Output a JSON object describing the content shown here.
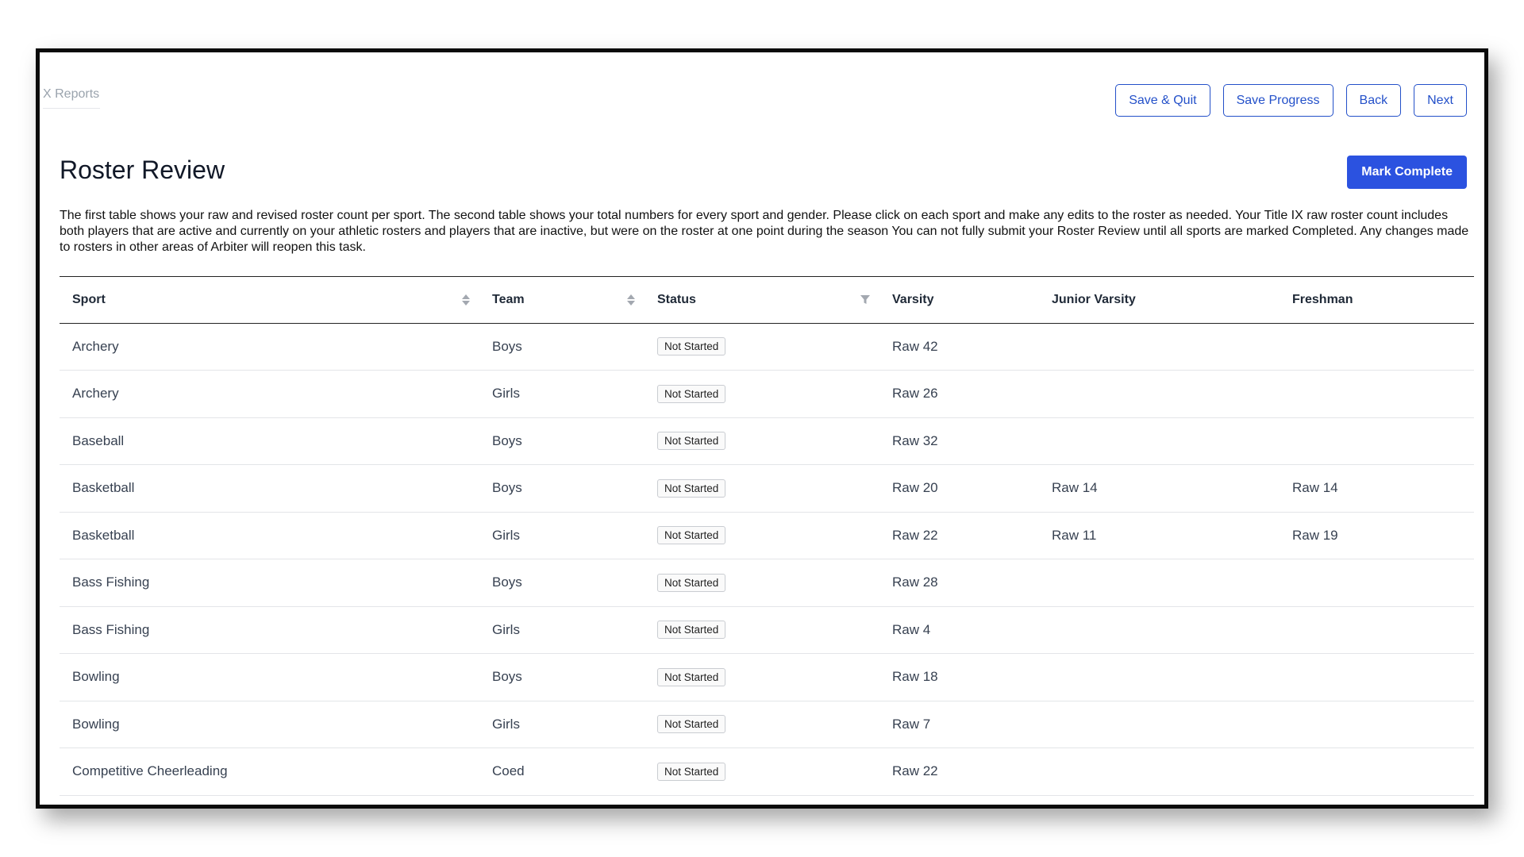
{
  "breadcrumb": "X Reports",
  "actions": {
    "save_quit": "Save & Quit",
    "save_progress": "Save Progress",
    "back": "Back",
    "next": "Next",
    "mark_complete": "Mark Complete"
  },
  "page_title": "Roster Review",
  "description": "The first table shows your raw and revised roster count per sport. The second table shows your total numbers for every sport and gender. Please click on each sport and make any edits to the roster as needed. Your Title IX raw roster count includes both players that are active and currently on your athletic rosters and players that are inactive, but were on the roster at one point during the season You can not fully submit your Roster Review until all sports are marked Completed. Any changes made to rosters in other areas of Arbiter will reopen this task.",
  "table": {
    "columns": {
      "sport": "Sport",
      "team": "Team",
      "status": "Status",
      "varsity": "Varsity",
      "jv": "Junior Varsity",
      "freshman": "Freshman"
    },
    "rows": [
      {
        "sport": "Archery",
        "team": "Boys",
        "status": "Not Started",
        "varsity": "Raw 42",
        "jv": "",
        "freshman": ""
      },
      {
        "sport": "Archery",
        "team": "Girls",
        "status": "Not Started",
        "varsity": "Raw 26",
        "jv": "",
        "freshman": ""
      },
      {
        "sport": "Baseball",
        "team": "Boys",
        "status": "Not Started",
        "varsity": "Raw 32",
        "jv": "",
        "freshman": ""
      },
      {
        "sport": "Basketball",
        "team": "Boys",
        "status": "Not Started",
        "varsity": "Raw 20",
        "jv": "Raw 14",
        "freshman": "Raw 14"
      },
      {
        "sport": "Basketball",
        "team": "Girls",
        "status": "Not Started",
        "varsity": "Raw 22",
        "jv": "Raw 11",
        "freshman": "Raw 19"
      },
      {
        "sport": "Bass Fishing",
        "team": "Boys",
        "status": "Not Started",
        "varsity": "Raw 28",
        "jv": "",
        "freshman": ""
      },
      {
        "sport": "Bass Fishing",
        "team": "Girls",
        "status": "Not Started",
        "varsity": "Raw 4",
        "jv": "",
        "freshman": ""
      },
      {
        "sport": "Bowling",
        "team": "Boys",
        "status": "Not Started",
        "varsity": "Raw 18",
        "jv": "",
        "freshman": ""
      },
      {
        "sport": "Bowling",
        "team": "Girls",
        "status": "Not Started",
        "varsity": "Raw 7",
        "jv": "",
        "freshman": ""
      },
      {
        "sport": "Competitive Cheerleading",
        "team": "Coed",
        "status": "Not Started",
        "varsity": "Raw 22",
        "jv": "",
        "freshman": ""
      }
    ]
  },
  "colors": {
    "accent": "#2b52e0",
    "outline": "#2350c9"
  }
}
